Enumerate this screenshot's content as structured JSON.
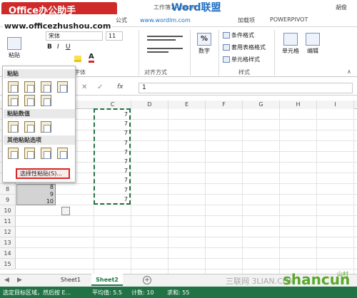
{
  "title": {
    "logo": "Office办公助手",
    "site": "www.officezhushou.com",
    "window_title": "工作簿1 - Excel",
    "user": "胡俊",
    "wm_brand": "Word联盟",
    "wm_url": "www.wordlm.com"
  },
  "tabs": [
    "公式",
    "加载项",
    "POWERPIVOT"
  ],
  "ribbon": {
    "paste_label": "粘贴",
    "font_name": "宋体",
    "font_size": "11",
    "font_group": "字体",
    "align_group": "对齐方式",
    "number_btn": "数字",
    "percent_icon": "%",
    "conditional_format": "条件格式",
    "table_format": "套用表格格式",
    "cell_style": "单元格样式",
    "style_group": "样式",
    "cells_btn": "单元格",
    "edit_btn": "编辑"
  },
  "formula_bar": {
    "fx": "fx",
    "value": "1"
  },
  "columns": [
    "C",
    "D",
    "E",
    "F",
    "G",
    "H",
    "I"
  ],
  "rows": [
    "1",
    "2",
    "3",
    "4",
    "5",
    "6",
    "7",
    "8",
    "9",
    "10",
    "11",
    "12",
    "13",
    "14",
    "15",
    "16",
    "17",
    "18",
    "19"
  ],
  "col_c_values": [
    "7",
    "7",
    "7",
    "7",
    "7",
    "7",
    "7",
    "7",
    "7",
    "7"
  ],
  "col_a_values": {
    "r8": "8",
    "r9": "9",
    "r10": "10"
  },
  "paste_menu": {
    "header1": "粘贴",
    "header2": "粘贴数值",
    "header3": "其他粘贴选项",
    "special": "选择性粘贴(S)..."
  },
  "sheets": [
    "Sheet1",
    "Sheet2"
  ],
  "status": {
    "left": "选定目标区域，然后按 E...",
    "avg": "平均值: 5.5",
    "count": "计数: 10",
    "sum": "求和: 55",
    "wm1": "三联网 3LIAN.COM",
    "wm2": "shancun",
    "wm3": "山村"
  },
  "colors": {
    "excel_green": "#217346",
    "logo_red": "#cf2a2a",
    "highlight_red": "#d62828"
  }
}
